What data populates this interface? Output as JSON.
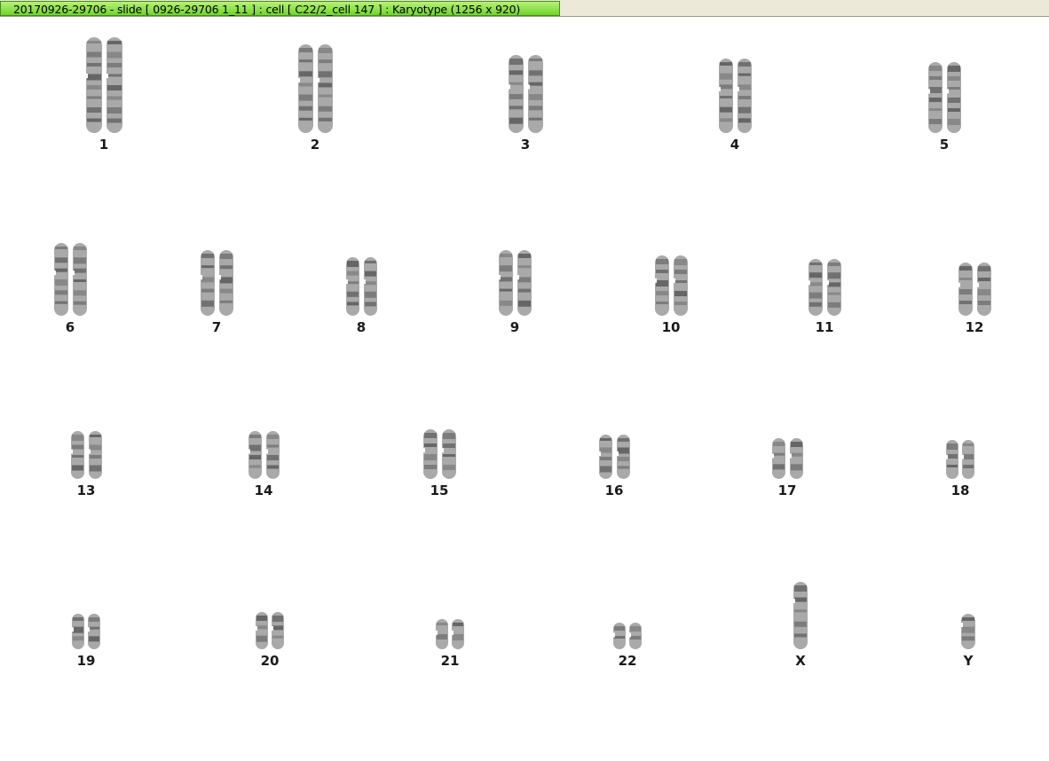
{
  "window": {
    "title": "20170926-29706 - slide [ 0926-29706 1_11 ] : cell [ C22/2_cell 147 ] : Karyotype  (1256 x 920)",
    "accent": "#7edc34"
  },
  "karyotype": {
    "chromosomes": [
      {
        "label": "1"
      },
      {
        "label": "2"
      },
      {
        "label": "3"
      },
      {
        "label": "4"
      },
      {
        "label": "5"
      },
      {
        "label": "6"
      },
      {
        "label": "7"
      },
      {
        "label": "8"
      },
      {
        "label": "9"
      },
      {
        "label": "10"
      },
      {
        "label": "11"
      },
      {
        "label": "12"
      },
      {
        "label": "13"
      },
      {
        "label": "14"
      },
      {
        "label": "15"
      },
      {
        "label": "16"
      },
      {
        "label": "17"
      },
      {
        "label": "18"
      },
      {
        "label": "19"
      },
      {
        "label": "20"
      },
      {
        "label": "21"
      },
      {
        "label": "22"
      },
      {
        "label": "X"
      },
      {
        "label": "Y"
      }
    ]
  }
}
